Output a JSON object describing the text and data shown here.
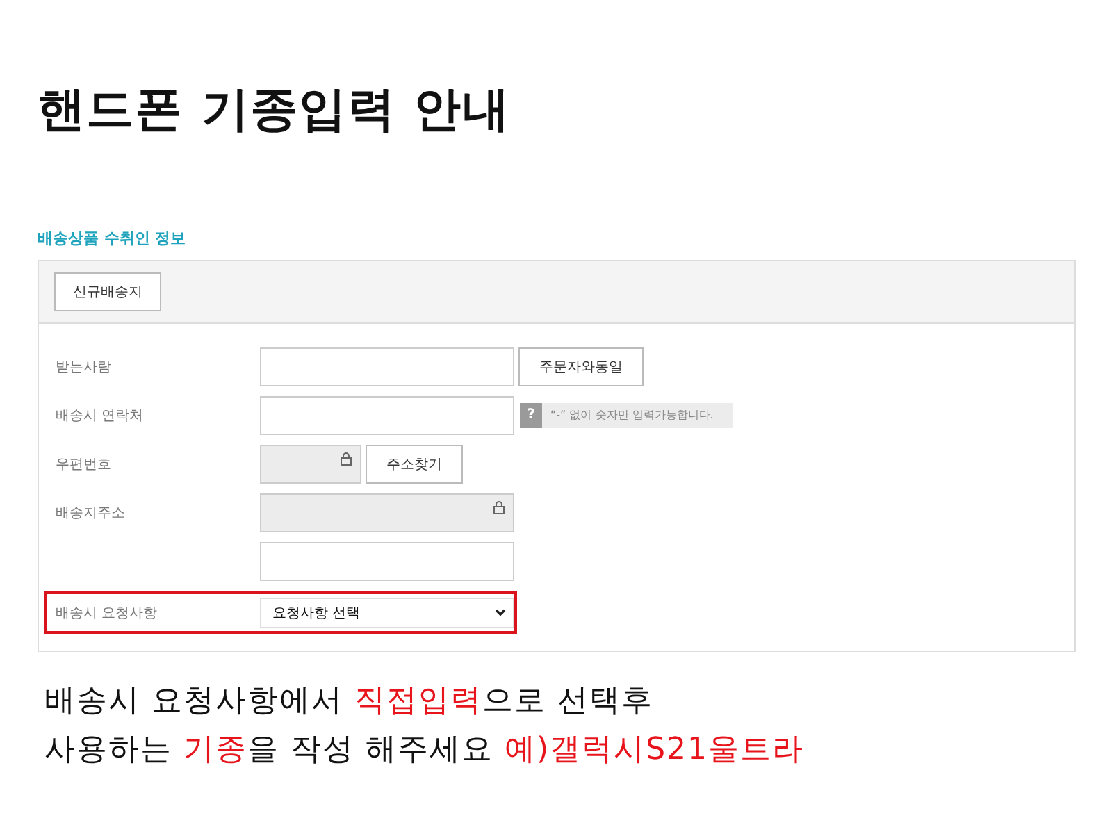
{
  "title": "핸드폰 기종입력 안내",
  "section_title": "배송상품 수취인 정보",
  "tab_button": "신규배송지",
  "rows": [
    {
      "kind": "text",
      "label": "받는사람",
      "button": "주문자와동일"
    },
    {
      "kind": "hint",
      "label": "배송시 연락처",
      "hint_icon": "?",
      "hint": "“-” 없이 숫자만 입력가능합니다."
    },
    {
      "kind": "locked",
      "label": "우편번호",
      "button": "주소찾기"
    },
    {
      "kind": "locked",
      "label": "배송지주소"
    },
    {
      "kind": "text"
    },
    {
      "kind": "select",
      "label": "배송시 요청사항",
      "value": "요청사항 선택",
      "highlighted": true
    }
  ],
  "instructions": [
    [
      {
        "text": "배송시 요청사항에서 ",
        "emphasis": false
      },
      {
        "text": "직접입력",
        "emphasis": true
      },
      {
        "text": "으로 선택후",
        "emphasis": false
      }
    ],
    [
      {
        "text": "사용하는 ",
        "emphasis": false
      },
      {
        "text": "기종",
        "emphasis": true
      },
      {
        "text": "을 작성 해주세요 ",
        "emphasis": false
      },
      {
        "text": "예)갤럭시S21울트라",
        "emphasis": true
      }
    ]
  ]
}
